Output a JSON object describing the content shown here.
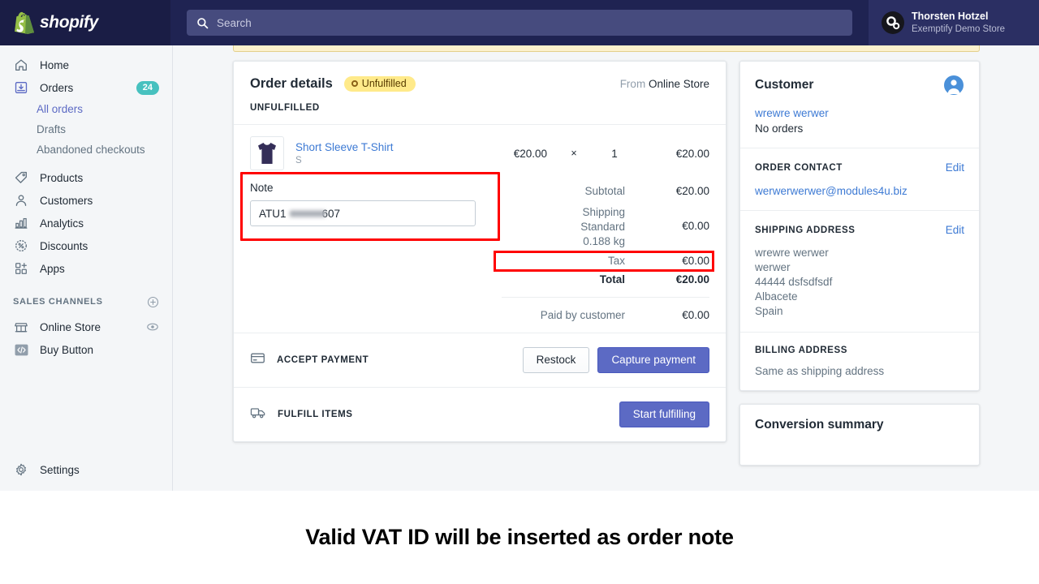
{
  "topbar": {
    "brand": "shopify",
    "search_placeholder": "Search",
    "user_name": "Thorsten Hotzel",
    "store_name": "Exemptify Demo Store"
  },
  "sidebar": {
    "items": [
      {
        "label": "Home",
        "icon": "home-icon",
        "badge": ""
      },
      {
        "label": "Orders",
        "icon": "orders-icon",
        "badge": "24"
      },
      {
        "label": "Products",
        "icon": "products-tag-icon",
        "badge": ""
      },
      {
        "label": "Customers",
        "icon": "customers-icon",
        "badge": ""
      },
      {
        "label": "Analytics",
        "icon": "analytics-bar-icon",
        "badge": ""
      },
      {
        "label": "Discounts",
        "icon": "discount-percent-icon",
        "badge": ""
      },
      {
        "label": "Apps",
        "icon": "apps-grid-icon",
        "badge": ""
      }
    ],
    "order_subitems": [
      {
        "label": "All orders",
        "active": true
      },
      {
        "label": "Drafts",
        "active": false
      },
      {
        "label": "Abandoned checkouts",
        "active": false
      }
    ],
    "sales_channels_title": "SALES CHANNELS",
    "channels": [
      {
        "label": "Online Store",
        "icon": "store-icon",
        "action_icon": "eye-icon"
      },
      {
        "label": "Buy Button",
        "icon": "code-embed-icon",
        "action_icon": ""
      }
    ],
    "settings_label": "Settings"
  },
  "order": {
    "title": "Order details",
    "status_badge": "Unfulfilled",
    "from_prefix": "From",
    "from_source": "Online Store",
    "fulfillment_section": "UNFULFILLED",
    "line_item": {
      "name": "Short Sleeve T-Shirt",
      "variant": "S",
      "unit_price": "€20.00",
      "multiply": "×",
      "quantity": "1",
      "line_total": "€20.00"
    },
    "note": {
      "label": "Note",
      "value_prefix": "ATU1",
      "value_suffix": "607"
    },
    "totals": {
      "subtotal_label": "Subtotal",
      "subtotal_value": "€20.00",
      "shipping_label": "Shipping",
      "shipping_method": "Standard",
      "shipping_weight": "0.188 kg",
      "shipping_value": "€0.00",
      "tax_label": "Tax",
      "tax_value": "€0.00",
      "total_label": "Total",
      "total_value": "€20.00",
      "paid_label": "Paid by customer",
      "paid_value": "€0.00"
    },
    "accept_payment_label": "ACCEPT PAYMENT",
    "restock_button": "Restock",
    "capture_button": "Capture payment",
    "fulfill_items_label": "FULFILL ITEMS",
    "start_fulfilling_button": "Start fulfilling"
  },
  "customer_panel": {
    "title": "Customer",
    "customer_name": "wrewre werwer",
    "order_count": "No orders",
    "order_contact_title": "ORDER CONTACT",
    "order_contact_edit": "Edit",
    "email": "werwerwerwer@modules4u.biz",
    "shipping_title": "SHIPPING ADDRESS",
    "shipping_edit": "Edit",
    "shipping_lines": [
      "wrewre werwer",
      "werwer",
      "44444 dsfsdfsdf",
      "Albacete",
      "Spain"
    ],
    "billing_title": "BILLING ADDRESS",
    "billing_text": "Same as shipping address",
    "conversion_title": "Conversion summary"
  },
  "caption": {
    "text": "Valid VAT ID will be inserted as order note"
  },
  "colors": {
    "topbar_bg": "#1f2352",
    "logo_bg": "#1a1d45",
    "accent_purple": "#5c6ac4",
    "badge_teal": "#47c1bf",
    "status_yellow": "#ffea8a",
    "highlight_red": "#ff0000",
    "link_blue": "#3d7ad4"
  }
}
